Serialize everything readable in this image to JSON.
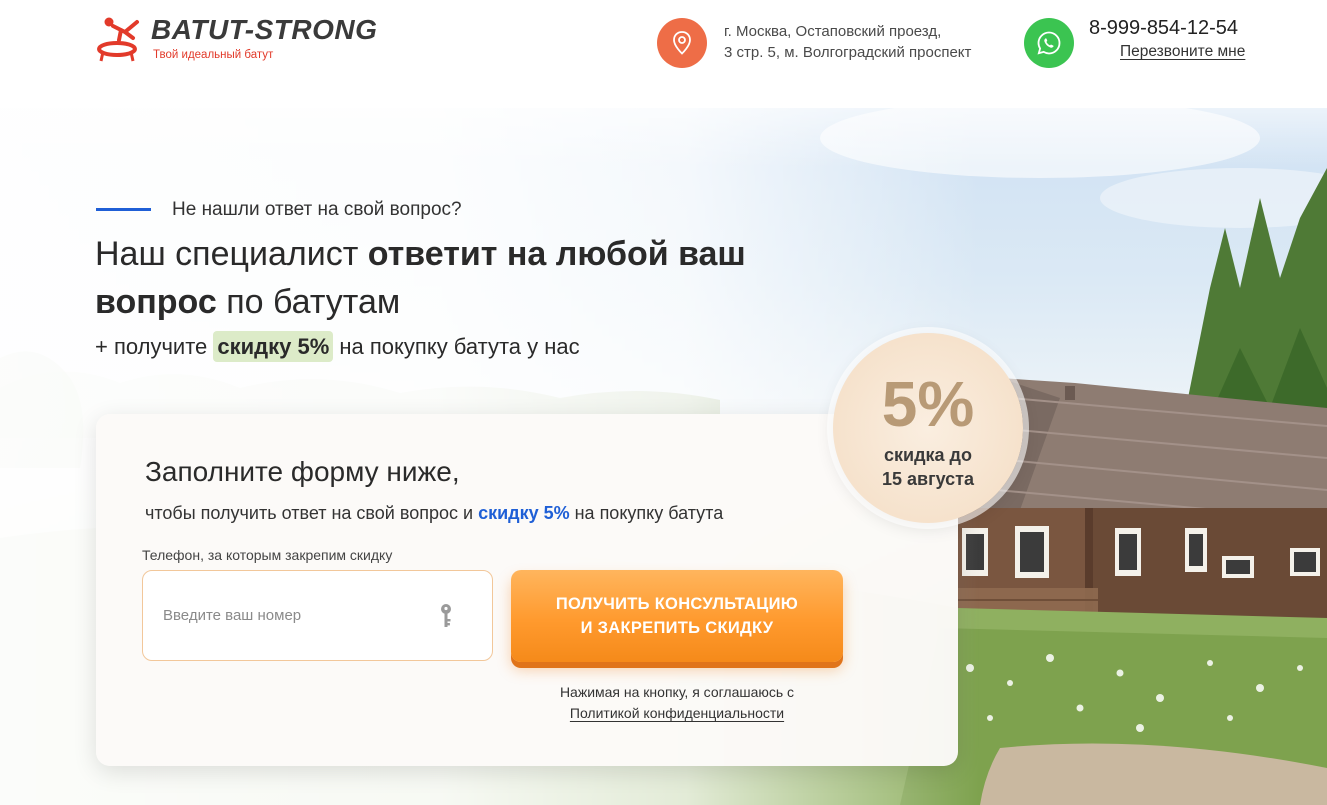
{
  "header": {
    "logo_title": "BATUT-STRONG",
    "logo_tagline": "Твой идеальный батут",
    "address_line1": "г. Москва, Остаповский проезд,",
    "address_line2": "3 стр. 5, м. Волгоградский проспект",
    "phone": "8-999-854-12-54",
    "callback_label": "Перезвоните мне"
  },
  "hero": {
    "eyebrow": "Не нашли ответ на свой вопрос?",
    "headline_part1": "Наш специалист ",
    "headline_bold1": "ответит на любой ваш вопрос",
    "headline_part2": " по батутам",
    "subline_prefix": "+ получите ",
    "subline_highlight": "скидку 5%",
    "subline_suffix": " на покупку батута у нас"
  },
  "form": {
    "title": "Заполните форму ниже,",
    "subtitle_prefix": "чтобы получить ответ на свой вопрос и ",
    "subtitle_highlight": "скидку 5%",
    "subtitle_suffix": " на покупку батута",
    "phone_label": "Телефон, за которым закрепим скидку",
    "phone_placeholder": "Введите ваш номер",
    "phone_value": "",
    "cta_line1": "ПОЛУЧИТЬ КОНСУЛЬТАЦИЮ",
    "cta_line2": "И ЗАКРЕПИТЬ СКИДКУ",
    "consent_text": "Нажимая на кнопку, я соглашаюсь с",
    "policy_link": "Политикой конфиденциальности"
  },
  "badge": {
    "percent": "5%",
    "line1": "скидка до",
    "line2": "15 августа"
  },
  "icons": {
    "logo": "trampoline-jumper-icon",
    "location": "map-pin-icon",
    "messenger": "whatsapp-icon",
    "field": "key-icon"
  },
  "colors": {
    "accent_blue": "#1f5fd6",
    "pin_orange": "#ee6d47",
    "whatsapp_green": "#3bc451",
    "cta_orange": "#ff9a2e",
    "logo_red": "#e23a2a"
  }
}
